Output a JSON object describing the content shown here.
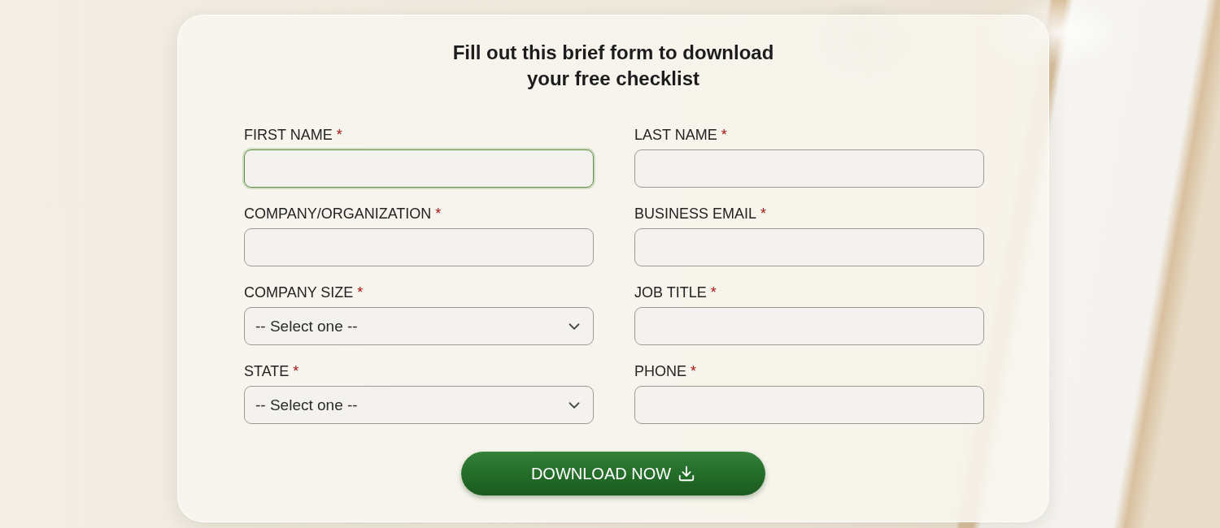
{
  "card": {
    "title_lines": [
      "Fill out this brief form to download",
      "your free checklist"
    ]
  },
  "fields": [
    {
      "label": "FIRST NAME",
      "mark": "*",
      "kind": "text",
      "focused": true
    },
    {
      "label": "LAST NAME",
      "mark": "*",
      "kind": "text",
      "focused": false
    },
    {
      "label": "COMPANY/ORGANIZATION",
      "mark": "*",
      "kind": "text",
      "focused": false
    },
    {
      "label": "BUSINESS EMAIL",
      "mark": "*",
      "kind": "text",
      "focused": false
    },
    {
      "label": "COMPANY SIZE",
      "mark": "*",
      "kind": "select",
      "placeholder": "-- Select one --",
      "focused": false
    },
    {
      "label": "JOB TITLE",
      "mark": "*",
      "kind": "text",
      "focused": false
    },
    {
      "label": "STATE",
      "mark": "*",
      "kind": "select",
      "placeholder": "-- Select one --",
      "focused": false
    },
    {
      "label": "PHONE",
      "mark": "*",
      "kind": "text",
      "focused": false
    }
  ],
  "button": {
    "label": "DOWNLOAD NOW"
  }
}
